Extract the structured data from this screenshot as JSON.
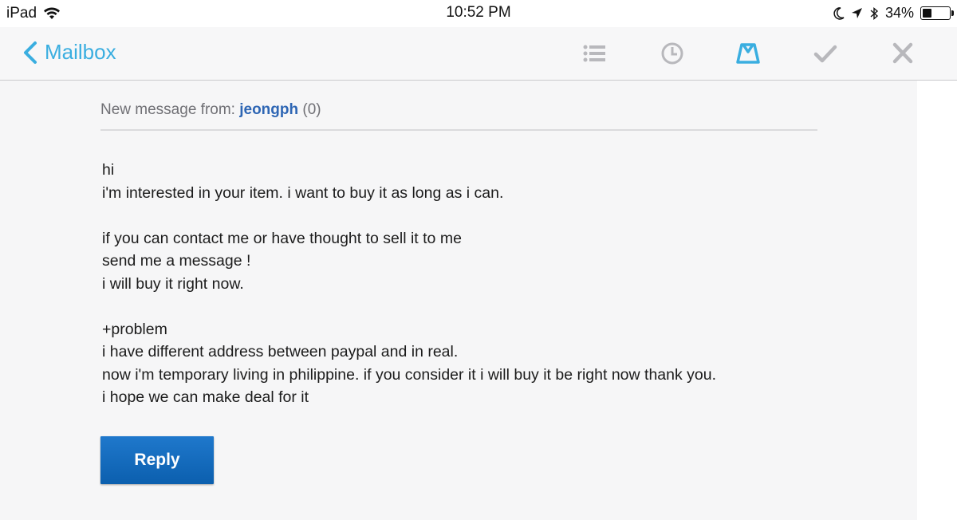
{
  "status_bar": {
    "device": "iPad",
    "time": "10:52 PM",
    "battery_text": "34%",
    "battery_level": 0.34
  },
  "nav": {
    "back_label": "Mailbox",
    "back_icon": "chevron-left-icon",
    "tools": [
      "list-icon",
      "clock-icon",
      "archive-tray-icon",
      "checkmark-icon",
      "close-icon"
    ],
    "accent_color": "#3aaee0",
    "tool_color": "#b8b8bc"
  },
  "message": {
    "from_prefix": "New message from:",
    "sender": "jeongph",
    "count": "(0)",
    "lines": [
      "hi",
      "i'm interested in your item. i want to buy it as long as i can.",
      "",
      "if you can contact me or have thought to sell it to me",
      "send me a message !",
      "i will buy it right now.",
      "",
      "+problem",
      "i have different address between paypal and in real.",
      "now i'm temporary living in philippine. if you consider it i will buy it be right now thank you.",
      "i hope we can make deal for it"
    ],
    "reply_label": "Reply",
    "reply_color": "#1465b8"
  }
}
